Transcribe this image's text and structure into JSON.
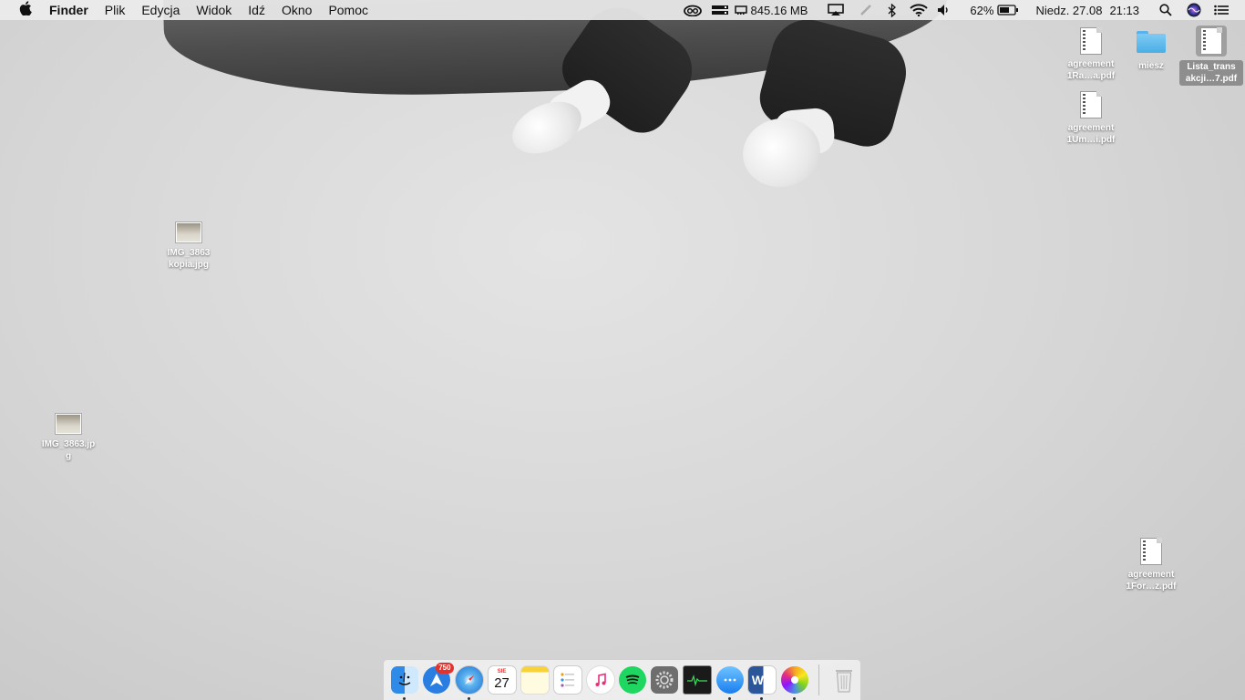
{
  "menubar": {
    "apple_icon": "apple-logo-icon",
    "app_name": "Finder",
    "menus": [
      "Plik",
      "Edycja",
      "Widok",
      "Idź",
      "Okno",
      "Pomoc"
    ],
    "memory_text": "845.16 MB",
    "battery_percent": "62%",
    "date": "Niedz. 27.08",
    "time": "21:13"
  },
  "desktop_icons": {
    "agreement_ra": "agreement 1Ra…a.pdf",
    "miesz": "miesz",
    "lista": "Lista_trans akcji…7.pdf",
    "agreement_um": "agreement 1Um…i.pdf",
    "img_kopia": "IMG_3863 kopia.jpg",
    "img": "IMG_3863.jpg",
    "agreement_for": "agreement 1For…z.pdf"
  },
  "dock": {
    "spark_badge": "750",
    "calendar_month": "SIE",
    "calendar_day": "27",
    "word_letter": "W"
  },
  "colors": {
    "menubar_bg": "#ececec",
    "folder_blue": "#57b3ea",
    "badge_red": "#e0332d"
  }
}
